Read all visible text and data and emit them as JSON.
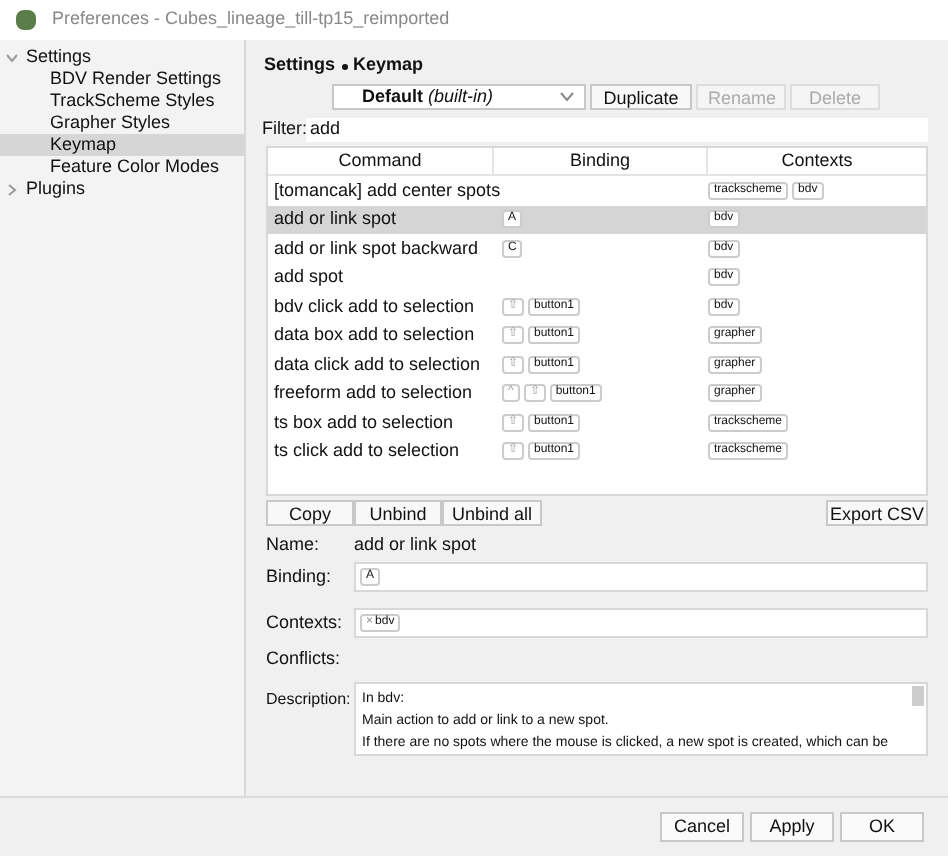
{
  "window": {
    "title": "Preferences - Cubes_lineage_till-tp15_reimported"
  },
  "sidebar": {
    "items": [
      {
        "label": "Settings",
        "expanded": true,
        "selected": false,
        "children": [
          {
            "label": "BDV Render Settings",
            "selected": false
          },
          {
            "label": "TrackScheme Styles",
            "selected": false
          },
          {
            "label": "Grapher Styles",
            "selected": false
          },
          {
            "label": "Keymap",
            "selected": true
          },
          {
            "label": "Feature Color Modes",
            "selected": false
          }
        ]
      },
      {
        "label": "Plugins",
        "expanded": false,
        "selected": false
      }
    ]
  },
  "breadcrumb": [
    "Settings",
    "Keymap"
  ],
  "keymap_selector": {
    "value": "**Default** *(built-in)*",
    "buttons": [
      {
        "label": "Duplicate",
        "disabled": false
      },
      {
        "label": "Rename",
        "disabled": true
      },
      {
        "label": "Delete",
        "disabled": true
      }
    ]
  },
  "filter": {
    "label": "Filter:",
    "value": "add"
  },
  "table": {
    "columns": [
      "Command",
      "Binding",
      "Contexts"
    ],
    "rows": [
      {
        "command": "[tomancak] add center spots",
        "binding": [],
        "contexts": [
          "trackscheme",
          "bdv"
        ],
        "selected": false
      },
      {
        "command": "add or link spot",
        "binding": [
          "A"
        ],
        "contexts": [
          "bdv"
        ],
        "selected": true
      },
      {
        "command": "add or link spot backward",
        "binding": [
          "C"
        ],
        "contexts": [
          "bdv"
        ],
        "selected": false
      },
      {
        "command": "add spot",
        "binding": [],
        "contexts": [
          "bdv"
        ],
        "selected": false
      },
      {
        "command": "bdv click add to selection",
        "binding": [
          "⇧",
          "button1"
        ],
        "contexts": [
          "bdv"
        ],
        "selected": false
      },
      {
        "command": "data box add to selection",
        "binding": [
          "⇧",
          "button1"
        ],
        "contexts": [
          "grapher"
        ],
        "selected": false
      },
      {
        "command": "data click add to selection",
        "binding": [
          "⇧",
          "button1"
        ],
        "contexts": [
          "grapher"
        ],
        "selected": false
      },
      {
        "command": "freeform add to selection",
        "binding": [
          "^",
          "⇧",
          "button1"
        ],
        "contexts": [
          "grapher"
        ],
        "selected": false
      },
      {
        "command": "ts box add to selection",
        "binding": [
          "⇧",
          "button1"
        ],
        "contexts": [
          "trackscheme"
        ],
        "selected": false
      },
      {
        "command": "ts click add to selection",
        "binding": [
          "⇧",
          "button1"
        ],
        "contexts": [
          "trackscheme"
        ],
        "selected": false
      }
    ]
  },
  "table_buttons": [
    "Copy",
    "Unbind",
    "Unbind all"
  ],
  "export_button": "Export CSV",
  "details": {
    "name_label": "Name:",
    "name": "add or link spot",
    "binding_label": "Binding:",
    "binding": [
      "A"
    ],
    "contexts_label": "Contexts:",
    "contexts": [
      "bdv"
    ],
    "context_remove": "×",
    "conflicts_label": "Conflicts:",
    "description_label": "Description:",
    "description": [
      "In bdv:",
      "Main action to add or link to a new spot.",
      "If there are no spots where the mouse is clicked, a new spot is created, which can be"
    ]
  },
  "footer_buttons": [
    "Cancel",
    "Apply",
    "OK"
  ]
}
